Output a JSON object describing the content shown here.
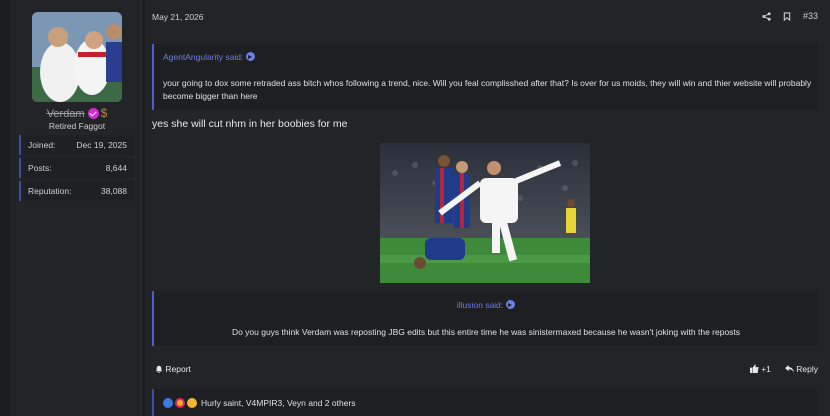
{
  "user": {
    "name": "Verdam",
    "title": "Retired Faggot",
    "stats": [
      {
        "label": "Joined:",
        "value": "Dec 19, 2025"
      },
      {
        "label": "Posts:",
        "value": "8,644"
      },
      {
        "label": "Reputation:",
        "value": "38,088"
      }
    ]
  },
  "post": {
    "date": "May 21, 2026",
    "number": "#33",
    "quote1": {
      "author": "AgentAngularity said:",
      "text": "your going to dox some retraded ass bitch whos following a trend, nice. Will you feal complisshed after that? Is over for us moids, they will win and thier website will probably become bigger than here"
    },
    "body": "yes she will cut nhm in her boobies for me",
    "quote2": {
      "author": "illusion said:",
      "text": "Do you guys think Verdam was reposting JBG edits but this entire time he was sinistermaxed because he wasn't joking with the reposts"
    },
    "actions": {
      "report": "Report",
      "plus": "+1",
      "reply": "Reply"
    },
    "reactions_text": "Hurly saint, V4MPIR3, Veyn and 2 others"
  },
  "icons": [
    "share-icon",
    "bookmark-icon",
    "report-icon",
    "like-icon",
    "reply-icon",
    "verified-icon",
    "money-bag-icon",
    "reaction-like-icon",
    "reaction-love-icon",
    "reaction-laugh-icon"
  ],
  "colors": {
    "accent": "#4a5fd0",
    "quote_author": "#6b7fe6",
    "verified": "#d12ad6"
  }
}
